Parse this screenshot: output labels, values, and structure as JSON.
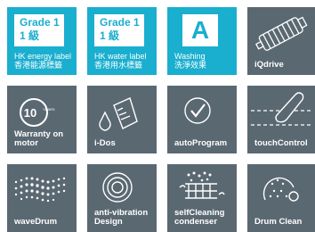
{
  "tiles": [
    {
      "badge_line1": "Grade 1",
      "badge_line2": "1 級",
      "caption_line1": "HK energy label",
      "caption_line2": "香港能源標籤"
    },
    {
      "badge_line1": "Grade 1",
      "badge_line2": "1 級",
      "caption_line1": "HK water label",
      "caption_line2": "香港用水標籤"
    },
    {
      "badge": "A",
      "caption_line1": "Washing",
      "caption_line2": "洗淨效果"
    },
    {
      "caption": "iQdrive",
      "icon": "motor-icon"
    },
    {
      "caption_line1": "Warranty on",
      "caption_line2": "motor",
      "badge_number": "10",
      "badge_text": "YEARS",
      "icon": "warranty-badge-icon"
    },
    {
      "caption": "i-Dos",
      "icon": "detergent-dosing-icon"
    },
    {
      "caption": "autoProgram",
      "icon": "check-circle-icon"
    },
    {
      "caption": "touchControl",
      "icon": "touch-finger-icon"
    },
    {
      "caption": "waveDrum",
      "icon": "wave-drum-icon"
    },
    {
      "caption_line1": "anti-vibration",
      "caption_line2": "Design",
      "icon": "anti-vibration-icon"
    },
    {
      "caption_line1": "selfCleaning",
      "caption_line2": "condenser",
      "icon": "self-cleaning-condenser-icon"
    },
    {
      "caption": "Drum Clean",
      "icon": "drum-clean-icon"
    }
  ],
  "colors": {
    "teal": "#1aaecf",
    "grey": "#5a6872",
    "white": "#ffffff"
  }
}
